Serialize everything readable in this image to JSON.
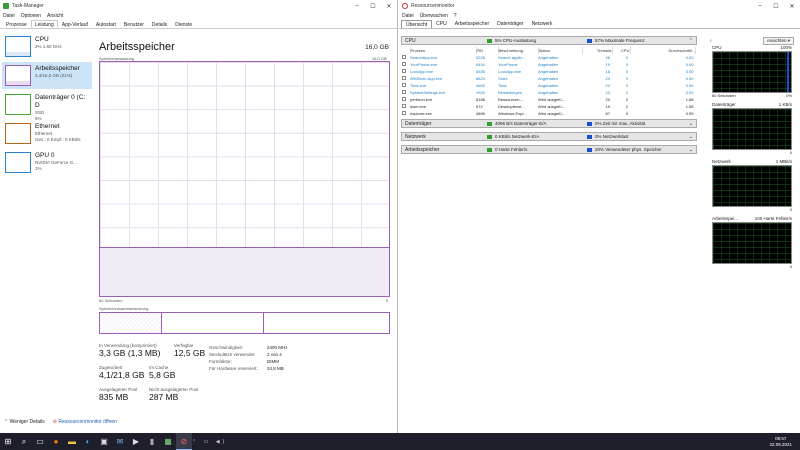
{
  "taskmanager": {
    "title": "Task-Manager",
    "menu": [
      "Datei",
      "Optionen",
      "Ansicht"
    ],
    "tabs": [
      "Prozesse",
      "Leistung",
      "App-Verlauf",
      "Autostart",
      "Benutzer",
      "Details",
      "Dienste"
    ],
    "active_tab": "Leistung",
    "side": [
      {
        "name": "CPU",
        "sub1": "2% 1,60 GHz",
        "sub2": "",
        "sub3": "",
        "color": "#2f7fd0"
      },
      {
        "name": "Arbeitsspeicher",
        "sub1": "3,4/16,0 GB (21%)",
        "sub2": "",
        "sub3": "",
        "color": "#9a5fb7"
      },
      {
        "name": "Datenträger 0 (C: D",
        "sub1": "SSD",
        "sub2": "5%",
        "sub3": "",
        "color": "#4aa335"
      },
      {
        "name": "Ethernet",
        "sub1": "Ethernet",
        "sub2": "Ges.: 0 Empf.: 0 KBit/s",
        "sub3": "",
        "color": "#b5651d"
      },
      {
        "name": "GPU 0",
        "sub1": "NVIDIA GeForce G...",
        "sub2": "1%",
        "sub3": "",
        "color": "#2f7fd0"
      }
    ],
    "mem_title": "Arbeitsspeicher",
    "mem_total": "16,0 GB",
    "usage_label": "Speicherauslastung",
    "usage_max": "16,0 GB",
    "time_label": "60 Sekunden",
    "time_zero": "0",
    "usage_fraction": 0.21,
    "composition_label": "Speicherzusammensetzung",
    "stats": {
      "in_use_label": "In Verwendung (komprimiert)",
      "in_use": "3,3 GB (1,3 MB)",
      "available_label": "Verfügbar",
      "available": "12,5 GB",
      "committed_label": "Zugesichert",
      "committed": "4,1/21,8 GB",
      "cached_label": "Im Cache",
      "cached": "5,8 GB",
      "paged_label": "Ausgelagerter Pool",
      "paged": "835 MB",
      "nonpaged_label": "Nicht ausgelagerter Pool",
      "nonpaged": "287 MB"
    },
    "kv": [
      {
        "k": "Geschwindigkeit:",
        "v": "2400 MHz"
      },
      {
        "k": "Steckplätze verwendet:",
        "v": "2 von 4"
      },
      {
        "k": "Formfaktor:",
        "v": "DIMM"
      },
      {
        "k": "Für Hardware reserviert:",
        "v": "34,8 MB"
      }
    ],
    "footer": {
      "less_details": "Weniger Details",
      "open_resmon": "Ressourcenmonitor öffnen"
    }
  },
  "resmon": {
    "title": "Ressourcenmonitor",
    "menu": [
      "Datei",
      "Überwachen",
      "?"
    ],
    "tabs": [
      "Übersicht",
      "CPU",
      "Arbeitsspeicher",
      "Datenträger",
      "Netzwerk"
    ],
    "cpu": {
      "title": "CPU",
      "badge1": "5% CPU-Auslastung",
      "badge2": "57% Maximale Frequenz",
      "columns": [
        "Prozess",
        "PID",
        "Beschreibung",
        "Status",
        "Threads",
        "CPU",
        "Durchschnittl..."
      ],
      "rows": [
        {
          "p": "SearchApp.exe",
          "pid": "5228",
          "d": "Search applic...",
          "s": "Angehalten",
          "t": "46",
          "c": "0",
          "a": "0.00",
          "sus": true
        },
        {
          "p": "YourPhone.exe",
          "pid": "6444",
          "d": "YourPhone",
          "s": "Angehalten",
          "t": "19",
          "c": "0",
          "a": "0.00",
          "sus": true
        },
        {
          "p": "LockApp.exe",
          "pid": "6636",
          "d": "LockApp.exe",
          "s": "Angehalten",
          "t": "16",
          "c": "0",
          "a": "0.00",
          "sus": true
        },
        {
          "p": "WinStore.App.exe",
          "pid": "8624",
          "d": "Store",
          "s": "Angehalten",
          "t": "23",
          "c": "0",
          "a": "0.00",
          "sus": true
        },
        {
          "p": "Time.exe",
          "pid": "4600",
          "d": "Time",
          "s": "Angehalten",
          "t": "24",
          "c": "0",
          "a": "0.00",
          "sus": true
        },
        {
          "p": "SystemSettings.exe",
          "pid": "1920",
          "d": "Einstellungen",
          "s": "Angehalten",
          "t": "23",
          "c": "0",
          "a": "0.00",
          "sus": true
        },
        {
          "p": "perfmon.exe",
          "pid": "6188",
          "d": "Ressourcen-...",
          "s": "Wird ausgefü...",
          "t": "20",
          "c": "2",
          "a": "1.68",
          "sus": false
        },
        {
          "p": "dwm.exe",
          "pid": "672",
          "d": "Desktopfenst...",
          "s": "Wird ausgefü...",
          "t": "19",
          "c": "2",
          "a": "1.55",
          "sus": false
        },
        {
          "p": "explorer.exe",
          "pid": "4896",
          "d": "Windows-Expl...",
          "s": "Wird ausgefü...",
          "t": "87",
          "c": "0",
          "a": "0.95",
          "sus": false
        }
      ]
    },
    "disk": {
      "title": "Datenträger",
      "badge1": "4096 B/s Datenträger-E/A",
      "badge2": "0% Zeit mit max. Aktivität"
    },
    "net": {
      "title": "Netzwerk",
      "badge1": "0 KBit/s Netzwerk-E/A",
      "badge2": "0% Netzwerklast"
    },
    "mem": {
      "title": "Arbeitsspeicher",
      "badge1": "0 Harte Fehler/s",
      "badge2": "20% Verwendeter phys. Speicher"
    },
    "views_button": "Ansichten",
    "graphs": [
      {
        "name": "CPU",
        "value": "100%",
        "foot_l": "60 Sekunden",
        "foot_r": "0%"
      },
      {
        "name": "Datenträger",
        "value": "1 KB/s",
        "foot_l": "",
        "foot_r": "0"
      },
      {
        "name": "Netzwerk",
        "value": "1 MBit/s",
        "foot_l": "",
        "foot_r": "0"
      },
      {
        "name": "Arbeitsspei...",
        "value": "100 Harte Fehler/s",
        "foot_l": "",
        "foot_r": "0"
      }
    ]
  },
  "taskbar": {
    "time": "08:57",
    "date": "22.09.2021"
  }
}
